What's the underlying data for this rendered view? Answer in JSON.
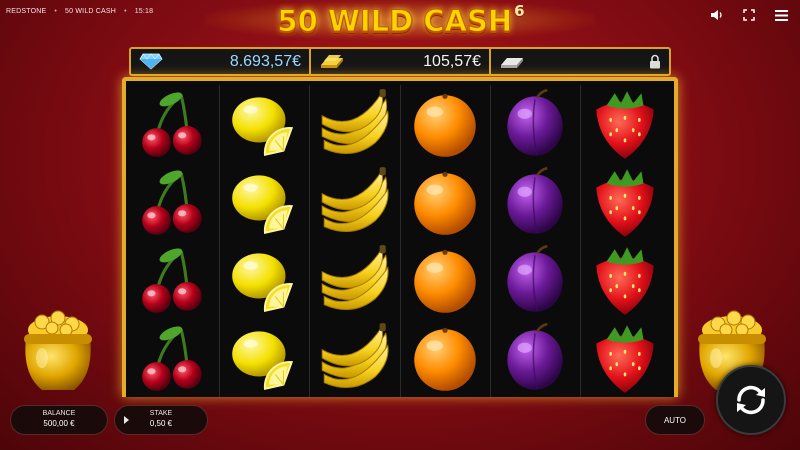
{
  "topbar": {
    "brand": "REDSTONE",
    "game": "50 WILD CASH",
    "time": "15:18"
  },
  "title": {
    "main": "50 WILD CASH",
    "sup": "6"
  },
  "jackpots": {
    "diamond": "8.693,57€",
    "gold": "105,57€"
  },
  "reels": [
    [
      "cherry",
      "cherry",
      "cherry",
      "cherry"
    ],
    [
      "lemon",
      "lemon",
      "lemon",
      "lemon"
    ],
    [
      "banana",
      "banana",
      "banana",
      "banana"
    ],
    [
      "orange",
      "orange",
      "orange",
      "orange"
    ],
    [
      "plum",
      "plum",
      "plum",
      "plum"
    ],
    [
      "strawberry",
      "strawberry",
      "strawberry",
      "strawberry"
    ]
  ],
  "controls": {
    "balance_label": "BALANCE",
    "balance_value": "500,00 €",
    "stake_label": "STAKE",
    "stake_value": "0,50 €",
    "auto_label": "AUTO"
  },
  "colors": {
    "frame_gold": "#e3ad2c",
    "background_red": "#8f0e15",
    "title_yellow": "#ffd400"
  },
  "icons": [
    "sound-icon",
    "fullscreen-icon",
    "menu-icon",
    "diamond-icon",
    "gold-bar-icon",
    "silver-bar-icon",
    "lock-icon",
    "play-icon",
    "spin-icon"
  ]
}
